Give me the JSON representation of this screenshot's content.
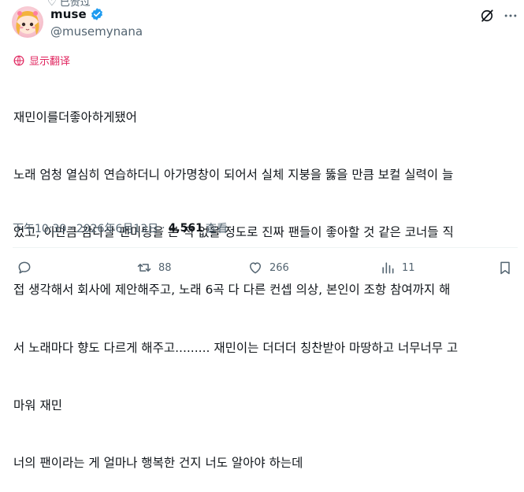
{
  "top_clip_text": "♡ 已赞过",
  "author": {
    "display_name": "muse",
    "handle": "@musemynana"
  },
  "translate_label": "显示翻译",
  "tweet_lines": [
    "재민이를더좋아하게됐어",
    "노래 엄청 열심히 연습하더니 아가명창이 되어서 실체 지붕을 뚫을 만큼 보컬 실력이 늘",
    "었고, 이만큼 감다살 팬미팅을 본 적 없을 정도로 진짜 팬들이 좋아할 것 같은 코너들 직",
    "접 생각해서 회사에 제안해주고, 노래 6곡 다 다른 컨셉 의상, 본인이 조항 참여까지 해",
    "서 노래마다 향도 다르게 해주고......... 재민이는 더더더 칭찬받아 마땅하고 너무너무 고",
    "마워 재민",
    "너의 팬이라는 게 얼마나 행복한 건지 너도 알아야 하는데"
  ],
  "meta": {
    "time": "下午10:39",
    "date": "2026年6月13日",
    "views_count": "4,561",
    "views_label": "查看"
  },
  "actions": {
    "reply_count": "",
    "retweet_count": "88",
    "like_count": "266",
    "views_count": "11"
  },
  "colors": {
    "accent_pink": "#e0245e",
    "verified_blue": "#1d9bf0",
    "secondary_text": "#536471"
  },
  "icons": {
    "verified": "verified-badge-icon",
    "grok": "grok-icon",
    "more": "more-icon",
    "translate": "translate-icon",
    "reply": "reply-icon",
    "retweet": "retweet-icon",
    "like": "heart-icon",
    "views": "views-icon",
    "bookmark": "bookmark-icon"
  }
}
